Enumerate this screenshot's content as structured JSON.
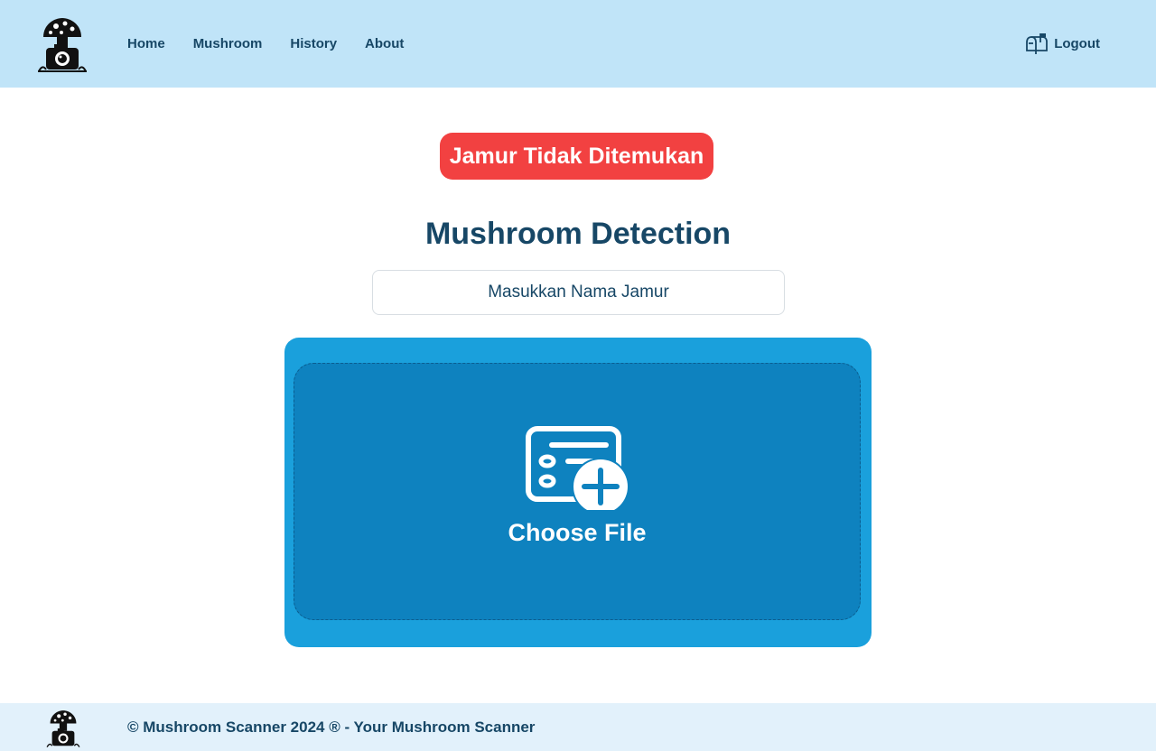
{
  "header": {
    "logo": "mushroom-camera-logo",
    "nav": [
      {
        "label": "Home"
      },
      {
        "label": "Mushroom"
      },
      {
        "label": "History"
      },
      {
        "label": "About"
      }
    ],
    "logout_label": "Logout",
    "logout_icon": "mailbox-icon",
    "background": "#c0e4f8"
  },
  "alert": {
    "text": "Jamur Tidak Ditemukan",
    "color": "#f24141"
  },
  "main": {
    "title": "Mushroom Detection",
    "name_input": {
      "placeholder": "Masukkan Nama Jamur",
      "value": ""
    },
    "upload": {
      "label": "Choose File",
      "icon": "file-add-icon",
      "outer_color": "#1aa0dc",
      "inner_color": "#0e82bf"
    }
  },
  "footer": {
    "text": "© Mushroom Scanner 2024 ® - Your Mushroom Scanner"
  }
}
